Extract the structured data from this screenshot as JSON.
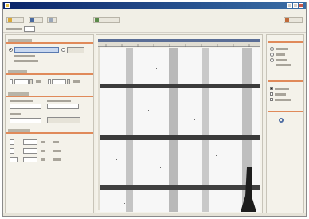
{
  "window": {
    "title": ""
  },
  "menus": [
    {
      "label": ""
    },
    {
      "label": ""
    },
    {
      "label": ""
    },
    {
      "label": ""
    },
    {
      "label": ""
    },
    {
      "label": ""
    },
    {
      "label": ""
    }
  ],
  "toolbar": {
    "open_label": "",
    "save_label": "",
    "copy_label": "",
    "process_label": "",
    "exit_label": ""
  },
  "address": {
    "label": "",
    "value": ""
  },
  "left": {
    "input_group": {
      "title": "",
      "file_value": "",
      "browse_label": "",
      "info_line_1": "",
      "info_line_2": ""
    },
    "range_group": {
      "title": "",
      "from_value": "",
      "to_value": "",
      "unit": ""
    },
    "process_group": {
      "title": "",
      "mode_label_a": "",
      "mode_label_b": "",
      "mode_value_a": "",
      "mode_value_b": "",
      "filter_label": "",
      "filter_value": "",
      "apply_label": ""
    },
    "result_group": {
      "title": "",
      "rows": [
        {
          "value": "",
          "unit": "",
          "result": ""
        },
        {
          "value": "",
          "unit": "",
          "result": ""
        },
        {
          "value": "",
          "unit": "",
          "result": ""
        }
      ]
    }
  },
  "viewer": {
    "title": ""
  },
  "right": {
    "display_group": {
      "title": "",
      "options": [
        "",
        "",
        "",
        ""
      ],
      "selected_index": 0
    },
    "overlay_group": {
      "title": "",
      "options": [
        "",
        "",
        ""
      ]
    },
    "export_group": {
      "title": ""
    }
  },
  "status": {
    "text": ""
  },
  "colors": {
    "accent": "#e08a5a",
    "titlebar": "#0a246a",
    "viewer_header": "#5b6e96",
    "grid_dark": "#3a3a3a",
    "grid_light": "#bdbdbd"
  }
}
